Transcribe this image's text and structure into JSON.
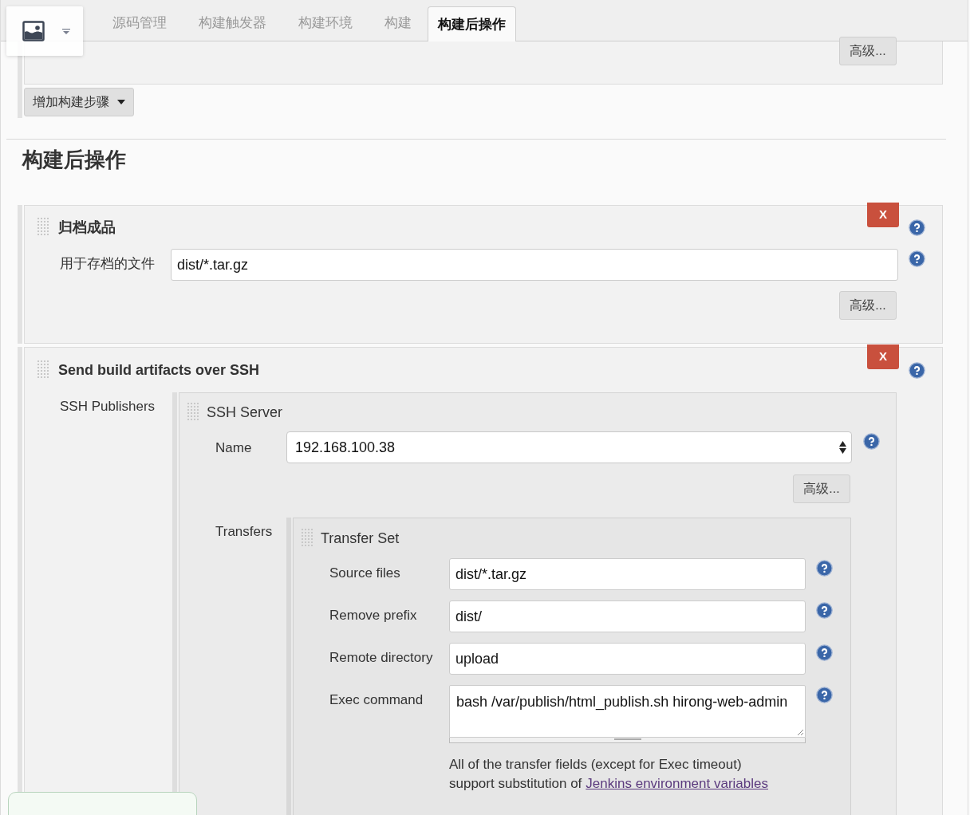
{
  "tabs": [
    {
      "label": "源码管理",
      "selected": false
    },
    {
      "label": "构建触发器",
      "selected": false
    },
    {
      "label": "构建环境",
      "selected": false
    },
    {
      "label": "构建",
      "selected": false
    },
    {
      "label": "构建后操作",
      "selected": true
    }
  ],
  "build_section": {
    "advanced_button": "高级...",
    "add_step_button": "增加构建步骤"
  },
  "heading": "构建后操作",
  "archive": {
    "title": "归档成品",
    "delete_button": "X",
    "files_label": "用于存档的文件",
    "files_value": "dist/*.tar.gz",
    "advanced_button": "高级..."
  },
  "ssh": {
    "title": "Send build artifacts over SSH",
    "delete_button": "X",
    "publishers_label": "SSH Publishers",
    "server": {
      "title": "SSH Server",
      "name_label": "Name",
      "name_value": "192.168.100.38",
      "advanced_button": "高级...",
      "transfers_label": "Transfers",
      "transfer_set": {
        "title": "Transfer Set",
        "fields": [
          {
            "label": "Source files",
            "value": "dist/*.tar.gz",
            "kind": "input"
          },
          {
            "label": "Remove prefix",
            "value": "dist/",
            "kind": "input"
          },
          {
            "label": "Remote directory",
            "value": "upload",
            "kind": "input"
          },
          {
            "label": "Exec command",
            "value": "bash /var/publish/html_publish.sh hirong-web-admin",
            "kind": "textarea"
          }
        ],
        "note": "All of the transfer fields (except for Exec timeout)",
        "note_line2": "support substitution of",
        "note_link": "Jenkins environment variables"
      }
    }
  }
}
